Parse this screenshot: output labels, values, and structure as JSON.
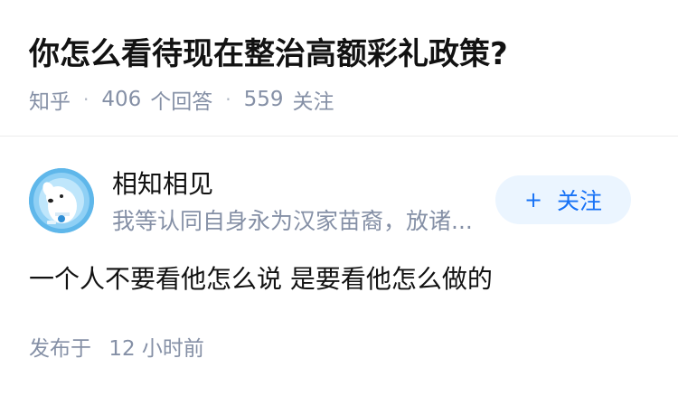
{
  "question": {
    "title": "你怎么看待现在整治高额彩礼政策?"
  },
  "meta": {
    "source": "知乎",
    "separator": "·",
    "answer_count": "406",
    "answer_label": "个回答",
    "follower_count": "559",
    "follower_label": "关注"
  },
  "answer": {
    "author": {
      "avatar_icon": "avatar-dog-icon",
      "name": "相知相见",
      "headline": "我等认同自身永为汉家苗裔，放诸..."
    },
    "follow_button": {
      "icon": "+",
      "label": "关注"
    },
    "content": "一个人不要看他怎么说 是要看他怎么做的",
    "published": {
      "prefix": "发布于",
      "time": "12 小时前"
    }
  },
  "colors": {
    "title": "#121212",
    "meta": "#8590a6",
    "follow_bg": "#ebf5ff",
    "follow_text": "#1772f6",
    "avatar_bg": "#5fb7ea"
  }
}
